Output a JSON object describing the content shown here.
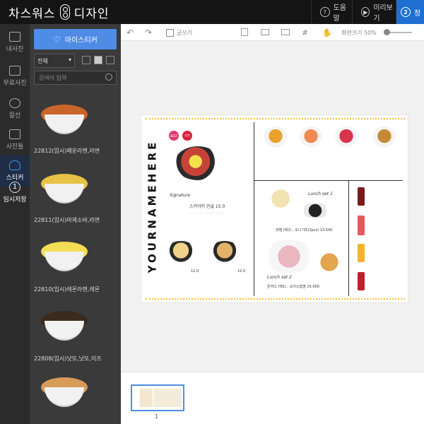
{
  "app": {
    "logo_left": "차스워스",
    "logo_right": "디자인",
    "help_label": "도움말",
    "preview_label": "미리보기",
    "save_label": "2",
    "save_text": "정"
  },
  "rail": {
    "items": [
      {
        "label": "내사진"
      },
      {
        "label": "무료사진"
      },
      {
        "label": "칼선"
      },
      {
        "label": "사진틀"
      },
      {
        "label": "스티커"
      },
      {
        "label": "임시저장",
        "num": "1"
      }
    ]
  },
  "panel": {
    "mysticker_label": "마이스티커",
    "filter_value": "전체",
    "search_placeholder": "검색어 입력",
    "stickers": [
      {
        "caption": "22812(임시)매운라멘,라면",
        "food_color": "#c9652a"
      },
      {
        "caption": "22811(임시)마제소바,라면",
        "food_color": "#e6c246"
      },
      {
        "caption": "22810(임시)레몬라멘,레몬",
        "food_color": "#f3dd55"
      },
      {
        "caption": "22808(임시)낫또,낫또,이즈",
        "food_color": "#3b2b1e"
      },
      {
        "caption": "",
        "food_color": "#d89b58"
      }
    ]
  },
  "toolbar": {
    "undo": "↶",
    "redo": "↷",
    "text_label": "글쓰기",
    "zoom_label": "화면크기 50%",
    "zoom_percent": 50
  },
  "menu": {
    "vertical_title": "YOURNAMEHERE",
    "badge1": "BEST",
    "badge2": "추천",
    "signature": "Signature",
    "main_name": "스키야키 전골 15.0",
    "lunch1": "Lunch set 1",
    "lunch2": "Lunch set 2",
    "price1": "12.0",
    "price2": "12.0",
    "lunch1_line": "라멘 (택1) , 오니기리(2pcs) 13.500",
    "lunch2_line": "돈까스 (택1) , 오이스팁땅 15.000"
  },
  "pages": {
    "count_label": "1"
  }
}
